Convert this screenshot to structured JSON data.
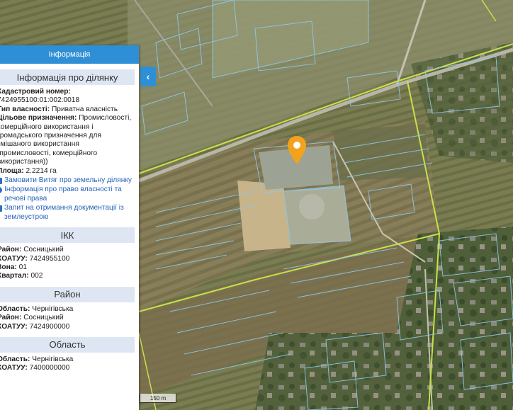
{
  "panel": {
    "header_title": "Інформація",
    "parcel": {
      "section_title": "Інформація про ділянку",
      "cadastral_label": "Кадастровий номер:",
      "cadastral_value": "7424955100:01:002:0018",
      "ownership_label": "Тип власності:",
      "ownership_value": "Приватна власність",
      "purpose_label": "Цільове призначення:",
      "purpose_value": "Промисловості, комерційного використання і громадського призначення для змішаного використання (промисловості, комерційного використання))",
      "area_label": "Площа:",
      "area_value": "2.2214 га",
      "links": [
        {
          "label": "Замовити Витяг про земельну ділянку",
          "icon": "document-icon"
        },
        {
          "label": "Інформація про право власності та речові права",
          "icon": "info-icon"
        },
        {
          "label": "Запит на отримання документації із землеустрою",
          "icon": "document-icon"
        }
      ]
    },
    "ikk": {
      "section_title": "ІКК",
      "district_label": "Район:",
      "district_value": "Сосницький",
      "koatuu_label": "КОАТУУ:",
      "koatuu_value": "7424955100",
      "zone_label": "Зона:",
      "zone_value": "01",
      "quarter_label": "Квартал:",
      "quarter_value": "002"
    },
    "rayon": {
      "section_title": "Район",
      "oblast_label": "Область:",
      "oblast_value": "Чернігівська",
      "district_label": "Район:",
      "district_value": "Сосницький",
      "koatuu_label": "КОАТУУ:",
      "koatuu_value": "7424900000"
    },
    "oblast": {
      "section_title": "Область",
      "oblast_label": "Область:",
      "oblast_value": "Чернігівська",
      "koatuu_label": "КОАТУУ:",
      "koatuu_value": "7400000000"
    }
  },
  "collapse_button": {
    "glyph": "‹"
  },
  "scale": {
    "label": "150 m"
  },
  "colors": {
    "accent": "#2e8fd6",
    "section_bg": "#dfe6f3",
    "link": "#2563b8",
    "parcel_outline": "#8fc8e8",
    "boundary_line": "#c8e04a",
    "marker": "#f2a21b"
  }
}
